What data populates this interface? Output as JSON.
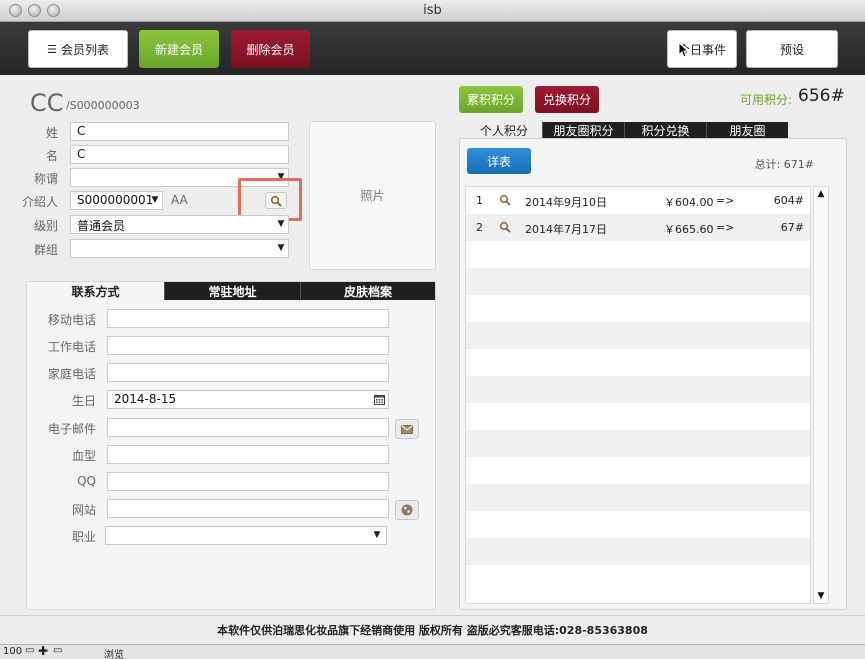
{
  "window": {
    "title": "isb"
  },
  "toolbar": {
    "member_list": "会员列表",
    "new_member": "新建会员",
    "delete_member": "删除会员",
    "today_events": "今日事件",
    "presets": "预设"
  },
  "member": {
    "name": "CC",
    "id": "/S000000003",
    "labels": {
      "surname": "姓",
      "given": "名",
      "title": "称谓",
      "referrer": "介绍人",
      "level": "级别",
      "group": "群组"
    },
    "surname": "C",
    "given": "C",
    "title": "",
    "referrer_id": "S000000001",
    "referrer_name": "AA",
    "level": "普通会员",
    "group": "",
    "photo_label": "照片"
  },
  "contact_tabs": [
    "联系方式",
    "常驻地址",
    "皮肤档案"
  ],
  "contact": {
    "labels": {
      "mobile": "移动电话",
      "work": "工作电话",
      "home": "家庭电话",
      "birthday": "生日",
      "email": "电子邮件",
      "blood": "血型",
      "qq": "QQ",
      "website": "网站",
      "job": "职业"
    },
    "mobile": "",
    "work": "",
    "home": "",
    "birthday": "2014-8-15",
    "email": "",
    "blood": "",
    "qq": "",
    "website": "",
    "job": ""
  },
  "points": {
    "accumulate_btn": "累积积分",
    "redeem_btn": "兑换积分",
    "available_label": "可用积分:",
    "available_value": "656#",
    "tabs": [
      "个人积分",
      "朋友圈积分",
      "积分兑换",
      "朋友圈"
    ],
    "detail_btn": "详表",
    "total": "总计: 671#",
    "records": [
      {
        "no": "1",
        "date": "2014年9月10日",
        "amount": "￥604.00",
        "arrow": "=>",
        "points": "604#"
      },
      {
        "no": "2",
        "date": "2014年7月17日",
        "amount": "￥665.60",
        "arrow": "=>",
        "points": "67#"
      }
    ]
  },
  "footer": {
    "text": "本软件仅供泊瑞思化妆品旗下经销商使用 版权所有 盗版必究客服电话:028-85363808"
  },
  "statusbar": {
    "zoom": "100",
    "mode": "浏览"
  }
}
